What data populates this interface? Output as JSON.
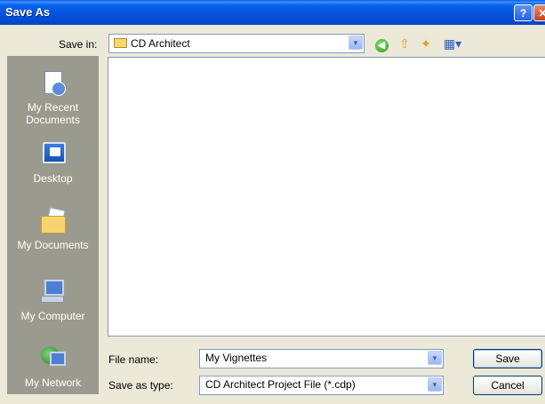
{
  "window": {
    "title": "Save As",
    "help_glyph": "?",
    "close_glyph": "✕"
  },
  "toolbar": {
    "save_in_label": "Save in:",
    "save_in_value": "CD Architect",
    "icons": [
      "back-icon",
      "up-one-level-icon",
      "new-folder-icon",
      "views-menu-icon"
    ]
  },
  "places": [
    {
      "label": "My Recent Documents",
      "icon": "recent-documents-icon"
    },
    {
      "label": "Desktop",
      "icon": "desktop-icon"
    },
    {
      "label": "My Documents",
      "icon": "my-documents-icon"
    },
    {
      "label": "My Computer",
      "icon": "my-computer-icon"
    },
    {
      "label": "My Network",
      "icon": "my-network-icon"
    }
  ],
  "fields": {
    "file_name_label": "File name:",
    "file_name_value": "My Vignettes",
    "save_as_type_label": "Save as type:",
    "save_as_type_value": "CD Architect Project File (*.cdp)"
  },
  "buttons": {
    "save": "Save",
    "cancel": "Cancel"
  },
  "colors": {
    "titlebar": "#0a63ee",
    "dialog_bg": "#ece9d8",
    "places_bg": "#9b9a8f"
  }
}
